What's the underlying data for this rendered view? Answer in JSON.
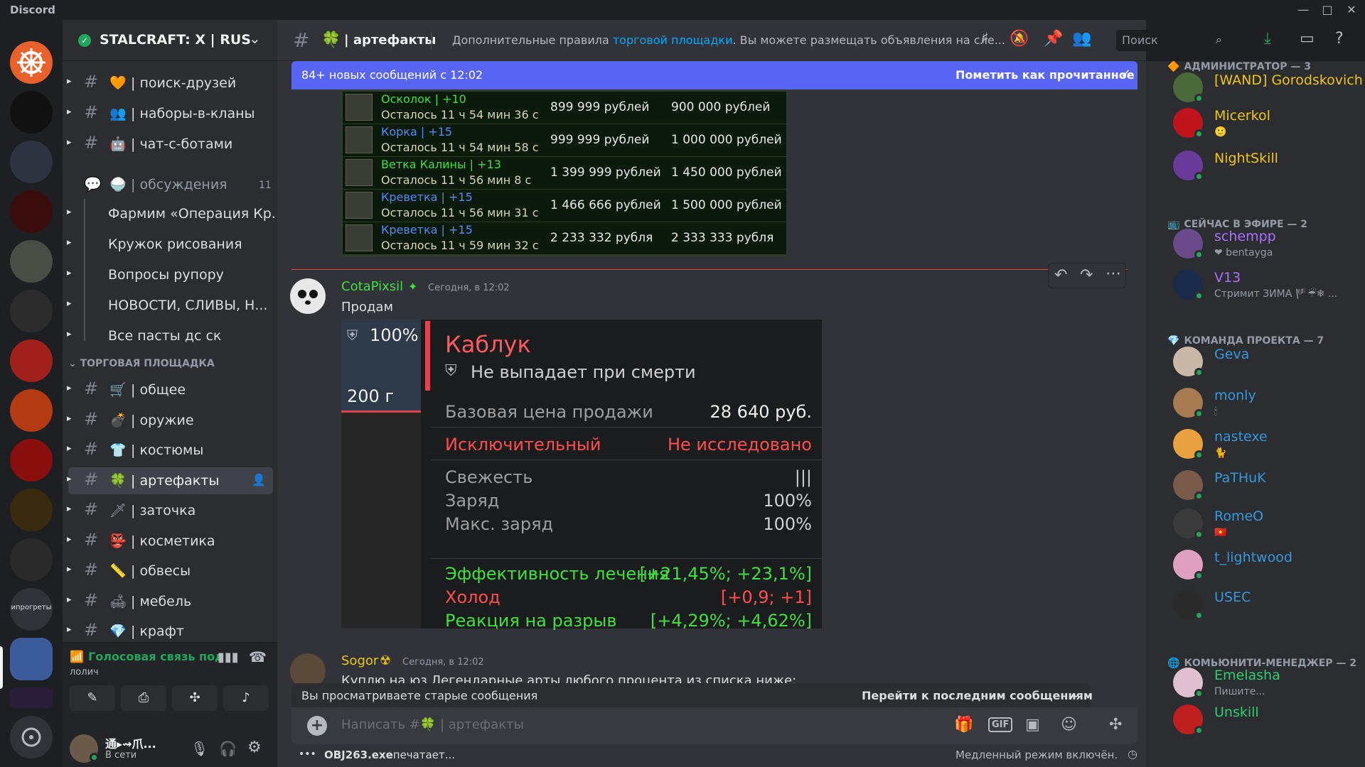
{
  "app": {
    "title": "Discord"
  },
  "server": {
    "name": "STALCRAFT: X | RUS"
  },
  "rail": {
    "folder_label": "ипрогреты"
  },
  "channels_top": [
    {
      "emoji": "🧡",
      "label": "| поиск-друзей"
    },
    {
      "emoji": "👥",
      "label": "| наборы-в-кланы"
    },
    {
      "emoji": "🤖",
      "label": "| чат-с-ботами"
    }
  ],
  "forum": {
    "emoji": "🍚",
    "label": "| обсуждения",
    "count": "11"
  },
  "threads": [
    "Фармим «Операция Кр...",
    "Кружок рисования",
    "Вопросы рупору",
    "НОВОСТИ, СЛИВЫ, Н...",
    "Все пасты дс ск"
  ],
  "category": {
    "label": "ТОРГОВАЯ ПЛОЩАДКА"
  },
  "channels_trade": [
    {
      "emoji": "🛒",
      "label": "| общее"
    },
    {
      "emoji": "💣",
      "label": "| оружие"
    },
    {
      "emoji": "👕",
      "label": "| костюмы"
    },
    {
      "emoji": "🍀",
      "label": "| артефакты"
    },
    {
      "emoji": "🗡",
      "label": "| заточка"
    },
    {
      "emoji": "👺",
      "label": "| косметика"
    },
    {
      "emoji": "📏",
      "label": "| обвесы"
    },
    {
      "emoji": "🛋",
      "label": "| мебель"
    },
    {
      "emoji": "💎",
      "label": "| крафт"
    }
  ],
  "voice": {
    "title": "Голосовая связь под",
    "sub": "лолич"
  },
  "user": {
    "name": "通▸⇝爪...",
    "status": "В сети"
  },
  "header": {
    "channel_emoji": "🍀",
    "channel_name": "| артефакты",
    "topic_prefix": "Дополнительные правила ",
    "topic_link": "торговой площадки",
    "topic_suffix": ". Вы можете размещать объявления на сле...",
    "search_placeholder": "Поиск"
  },
  "banner": {
    "text": "84+ новых сообщений с 12:02",
    "action": "Пометить как прочитанное"
  },
  "game_table": {
    "rows": [
      {
        "name": "Осколок | +10",
        "time": "Осталось 11 ч 54 мин 36 с",
        "price": "899 999 рублей",
        "buyout": "900 000 рублей",
        "color": "#3fdf3f"
      },
      {
        "name": "Корка | +15",
        "time": "Осталось 11 ч 54 мин 58 с",
        "price": "999 999 рублей",
        "buyout": "1 000 000 рублей",
        "color": "#4d8cff"
      },
      {
        "name": "Ветка Калины | +13",
        "time": "Осталось 11 ч 56 мин 8 с",
        "price": "1 399 999 рублей",
        "buyout": "1 450 000 рублей",
        "color": "#3fdf3f"
      },
      {
        "name": "Креветка | +15",
        "time": "Осталось 11 ч 56 мин 31 с",
        "price": "1 466 666 рублей",
        "buyout": "1 500 000 рублей",
        "color": "#4d8cff"
      },
      {
        "name": "Креветка | +15",
        "time": "Осталось 11 ч 59 мин 32 с",
        "price": "2 233 332 рубля",
        "buyout": "2 333 333 рубля",
        "color": "#4d8cff"
      }
    ]
  },
  "msg1": {
    "author": "CotaPixsil",
    "time": "Сегодня, в 12:02",
    "text": "Продам"
  },
  "item_card": {
    "percent": "100%",
    "weight": "200 г",
    "name": "Каблук",
    "nodrop": "Не выпадает при смерти",
    "base_price_label": "Базовая цена продажи",
    "base_price": "28 640 руб.",
    "rarity": "Исключительный",
    "research": "Не исследовано",
    "stats": [
      {
        "label": "Свежесть",
        "value": "|||"
      },
      {
        "label": "Заряд",
        "value": "100%"
      },
      {
        "label": "Макс. заряд",
        "value": "100%"
      }
    ],
    "effects": [
      {
        "label": "Эффективность лечения",
        "value": "[+21,45%; +23,1%]",
        "color": "#3fdf3f"
      },
      {
        "label": "Холод",
        "value": "[+0,9; +1]",
        "color": "#ff4d4d"
      },
      {
        "label": "Реакция на разрыв",
        "value": "[+4,29%; +4,62%]",
        "color": "#3fdf3f"
      }
    ]
  },
  "msg2": {
    "author": "Sogor",
    "time": "Сегодня, в 12:02",
    "text": "Куплю на юз Легендарные арты любого процента из списка ниже:"
  },
  "old_bar": {
    "text": "Вы просматриваете старые сообщения",
    "action": "Перейти к последним сообщениям"
  },
  "composer": {
    "placeholder": "Написать #🍀 | артефакты"
  },
  "footer": {
    "typing_user": "OBJ263.exe",
    "typing_text": " печатает...",
    "slowmode": "Медленный режим включён."
  },
  "members": {
    "groups": [
      {
        "title": "АДМИНИСТРАТОР — 3",
        "icon": "🔶"
      },
      {
        "title": "СЕЙЧАС В ЭФИРЕ — 2",
        "icon": "📺"
      },
      {
        "title": "КОМАНДА ПРОЕКТА — 7",
        "icon": "💎"
      },
      {
        "title": "КОМЬЮНИТИ-МЕНЕДЖЕР — 2",
        "icon": "🌐"
      }
    ],
    "list": [
      {
        "name": "[WAND] Gorodskovich",
        "sub": "",
        "color": "#f1c40f"
      },
      {
        "name": "Micerkol",
        "sub": "🙂",
        "color": "#f1c40f"
      },
      {
        "name": "NightSkill",
        "sub": "",
        "color": "#f1c40f"
      },
      {
        "name": "schempp",
        "sub": "❤ bentayga",
        "color": "#a970ff"
      },
      {
        "name": "V13",
        "sub": "Стримит ЗИМА 🏴☔❄ ...",
        "color": "#a970ff"
      },
      {
        "name": "Geva",
        "sub": "",
        "color": "#3498db"
      },
      {
        "name": "monly",
        "sub": "🕯",
        "color": "#3498db"
      },
      {
        "name": "nastexe",
        "sub": "🐈",
        "color": "#3498db"
      },
      {
        "name": "PaTHuK",
        "sub": "",
        "color": "#3498db"
      },
      {
        "name": "RomeO",
        "sub": "🇻🇳",
        "color": "#3498db"
      },
      {
        "name": "t_lightwood",
        "sub": "",
        "color": "#3498db"
      },
      {
        "name": "USEC",
        "sub": "",
        "color": "#3498db"
      },
      {
        "name": "Emelasha",
        "sub": "Пишите...",
        "color": "#2ecc71"
      },
      {
        "name": "Unskill",
        "sub": "",
        "color": "#2ecc71"
      }
    ]
  }
}
